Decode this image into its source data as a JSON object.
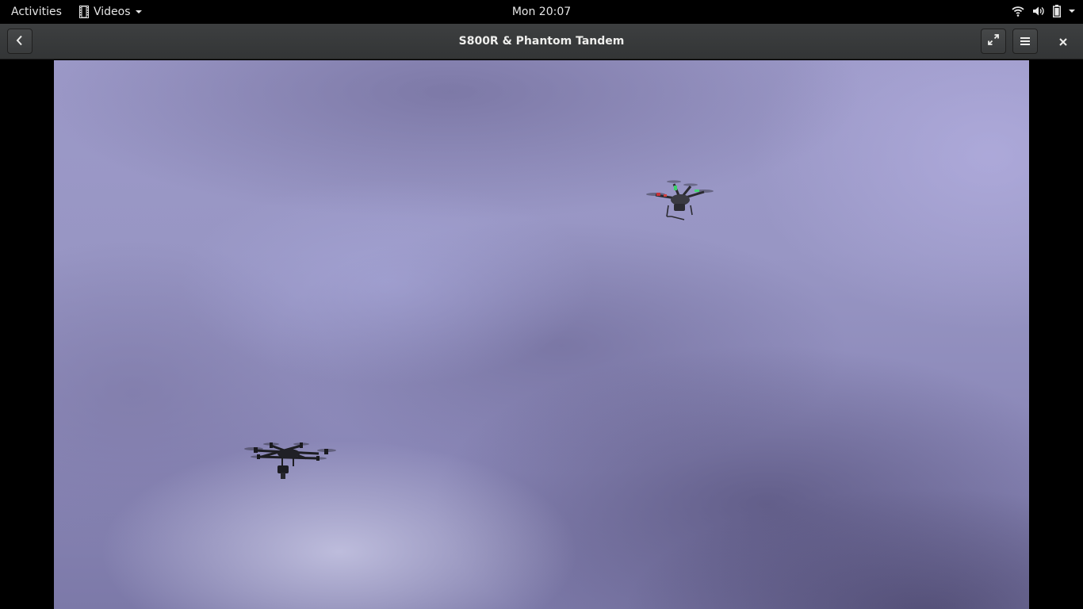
{
  "topbar": {
    "activities_label": "Activities",
    "app_menu_label": "Videos",
    "clock": "Mon 20:07",
    "status_icons": [
      "wifi-icon",
      "volume-icon",
      "battery-icon",
      "system-menu-arrow-icon"
    ]
  },
  "headerbar": {
    "title": "S800R & Phantom Tandem",
    "back_icon": "go-previous-icon",
    "fullscreen_icon": "view-fullscreen-icon",
    "menu_icon": "open-menu-icon",
    "close_icon": "window-close-icon"
  },
  "video": {
    "content": "sky-with-two-drones"
  },
  "colors": {
    "topbar_bg": "#000000",
    "headerbar_bg": "#363839",
    "text": "#eeeeec",
    "sky": "#9a97c6"
  }
}
